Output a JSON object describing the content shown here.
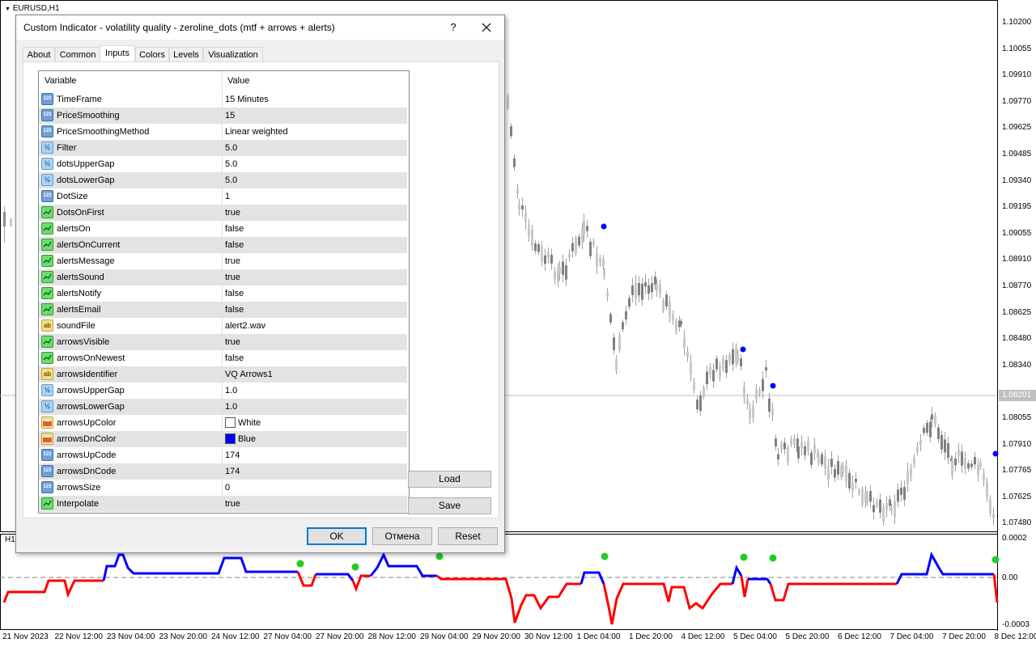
{
  "chart": {
    "symbol_label": "EURUSD,H1",
    "sub_window_label": "H1",
    "current_price": "1.08201",
    "price_axis": [
      "1.10200",
      "1.10055",
      "1.09910",
      "1.09770",
      "1.09625",
      "1.09485",
      "1.09340",
      "1.09195",
      "1.09055",
      "1.08910",
      "1.08770",
      "1.08625",
      "1.08480",
      "1.08340",
      "1.08201",
      "1.08055",
      "1.07910",
      "1.07765",
      "1.07625",
      "1.07480"
    ],
    "indicator_axis": [
      "0.0002",
      "0.00",
      "-0.0003"
    ],
    "date_axis": [
      "21 Nov 2023",
      "22 Nov 12:00",
      "23 Nov 04:00",
      "23 Nov 20:00",
      "24 Nov 12:00",
      "27 Nov 04:00",
      "27 Nov 20:00",
      "28 Nov 12:00",
      "29 Nov 04:00",
      "29 Nov 20:00",
      "30 Nov 12:00",
      "1 Dec 04:00",
      "1 Dec 20:00",
      "4 Dec 12:00",
      "5 Dec 04:00",
      "5 Dec 20:00",
      "6 Dec 12:00",
      "7 Dec 04:00",
      "7 Dec 20:00",
      "8 Dec 12:00"
    ],
    "colors": {
      "candle": "#808080",
      "up_line": "#0000ff",
      "down_line": "#ff0000",
      "dot": "#0000ff",
      "arrow": "#22cc22",
      "zero_line": "#808080"
    }
  },
  "dialog": {
    "title": "Custom Indicator - volatility quality - zeroline_dots (mtf + arrows + alerts)",
    "help_symbol": "?",
    "tabs": [
      "About",
      "Common",
      "Inputs",
      "Colors",
      "Levels",
      "Visualization"
    ],
    "active_tab": "Inputs",
    "columns": {
      "variable": "Variable",
      "value": "Value"
    },
    "rows": [
      {
        "name": "TimeFrame",
        "value": "15 Minutes",
        "icon": "int-icon"
      },
      {
        "name": "PriceSmoothing",
        "value": "15",
        "icon": "int-icon"
      },
      {
        "name": "PriceSmoothingMethod",
        "value": "Linear weighted",
        "icon": "int-icon"
      },
      {
        "name": "Filter",
        "value": "5.0",
        "icon": "double-icon"
      },
      {
        "name": "dotsUpperGap",
        "value": "5.0",
        "icon": "double-icon"
      },
      {
        "name": "dotsLowerGap",
        "value": "5.0",
        "icon": "double-icon"
      },
      {
        "name": "DotSize",
        "value": "1",
        "icon": "int-icon"
      },
      {
        "name": "DotsOnFirst",
        "value": "true",
        "icon": "bool-icon"
      },
      {
        "name": "alertsOn",
        "value": "false",
        "icon": "bool-icon"
      },
      {
        "name": "alertsOnCurrent",
        "value": "false",
        "icon": "bool-icon"
      },
      {
        "name": "alertsMessage",
        "value": "true",
        "icon": "bool-icon"
      },
      {
        "name": "alertsSound",
        "value": "true",
        "icon": "bool-icon"
      },
      {
        "name": "alertsNotify",
        "value": "false",
        "icon": "bool-icon"
      },
      {
        "name": "alertsEmail",
        "value": "false",
        "icon": "bool-icon"
      },
      {
        "name": "soundFile",
        "value": "alert2.wav",
        "icon": "string-icon"
      },
      {
        "name": "arrowsVisible",
        "value": "true",
        "icon": "bool-icon"
      },
      {
        "name": "arrowsOnNewest",
        "value": "false",
        "icon": "bool-icon"
      },
      {
        "name": "arrowsIdentifier",
        "value": "VQ Arrows1",
        "icon": "string-icon"
      },
      {
        "name": "arrowsUpperGap",
        "value": "1.0",
        "icon": "double-icon"
      },
      {
        "name": "arrowsLowerGap",
        "value": "1.0",
        "icon": "double-icon"
      },
      {
        "name": "arrowsUpColor",
        "value": "White",
        "icon": "color-icon",
        "swatch": "#ffffff"
      },
      {
        "name": "arrowsDnColor",
        "value": "Blue",
        "icon": "color-icon",
        "swatch": "#0000ff"
      },
      {
        "name": "arrowsUpCode",
        "value": "174",
        "icon": "int-icon"
      },
      {
        "name": "arrowsDnCode",
        "value": "174",
        "icon": "int-icon"
      },
      {
        "name": "arrowsSize",
        "value": "0",
        "icon": "int-icon"
      },
      {
        "name": "Interpolate",
        "value": "true",
        "icon": "bool-icon"
      }
    ],
    "buttons": {
      "load": "Load",
      "save": "Save",
      "ok": "OK",
      "cancel": "Отмена",
      "reset": "Reset"
    }
  }
}
